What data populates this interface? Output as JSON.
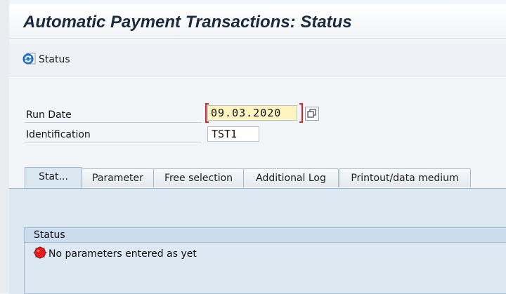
{
  "header": {
    "title": "Automatic Payment Transactions: Status"
  },
  "toolbar": {
    "status_label": "Status",
    "status_icon": "refresh-status-icon"
  },
  "form": {
    "run_date": {
      "label": "Run Date",
      "value": "09.03.2020"
    },
    "identification": {
      "label": "Identification",
      "value": "TST1"
    }
  },
  "tabs": [
    {
      "label": "Stat..."
    },
    {
      "label": "Parameter"
    },
    {
      "label": "Free selection"
    },
    {
      "label": "Additional Log"
    },
    {
      "label": "Printout/data medium"
    }
  ],
  "status_group": {
    "title": "Status",
    "message": "No parameters entered as yet",
    "message_icon": "red-light-icon"
  },
  "colors": {
    "required_marker": "#d8232a",
    "input_highlight": "#fdf4bf",
    "panel_bg": "#dce8f2"
  }
}
